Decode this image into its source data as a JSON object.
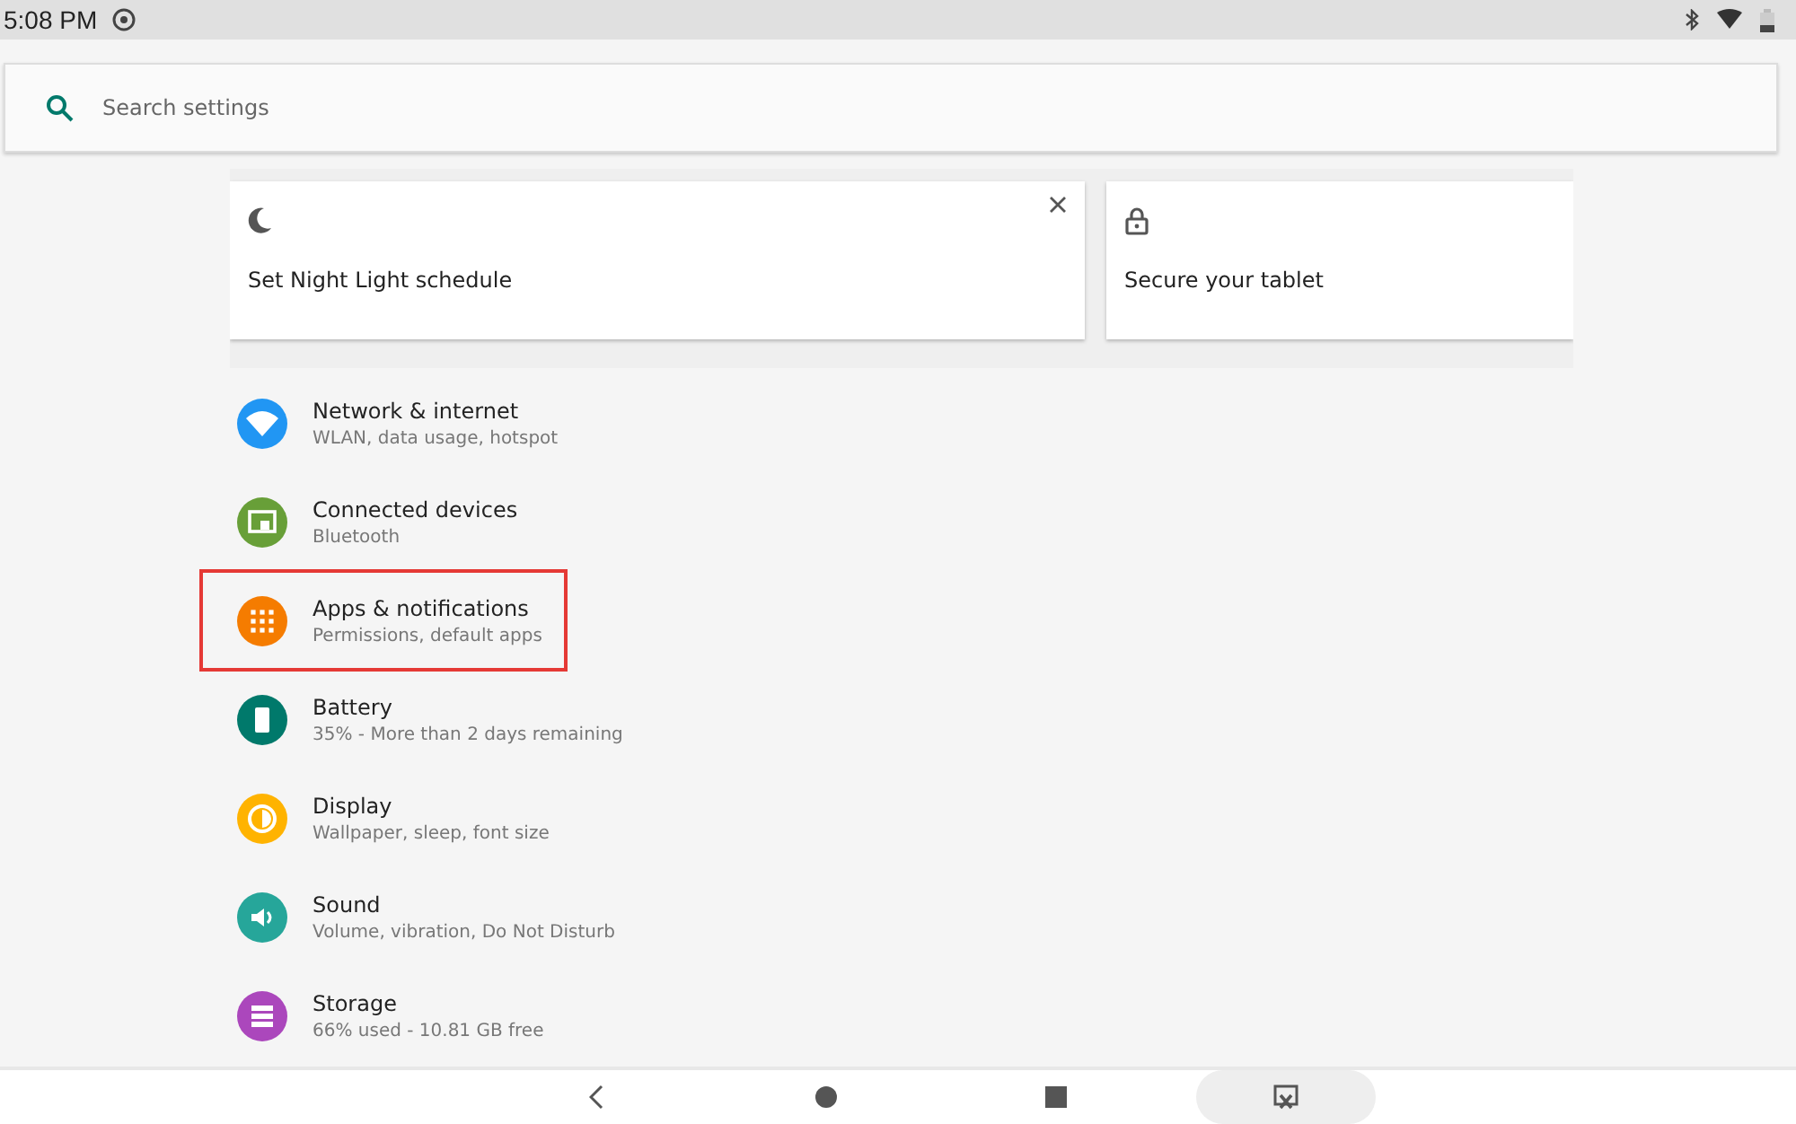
{
  "status_bar": {
    "time": "5:08 PM"
  },
  "search": {
    "placeholder": "Search settings"
  },
  "suggestions": [
    {
      "kind": "moon",
      "title": "Set Night Light schedule",
      "dismissible": true
    },
    {
      "kind": "lock",
      "title": "Secure your tablet",
      "dismissible": false
    }
  ],
  "items": [
    {
      "kind": "wifi",
      "color": "#2196f3",
      "title": "Network & internet",
      "subtitle": "WLAN, data usage, hotspot",
      "highlighted": false
    },
    {
      "kind": "devices",
      "color": "#689f38",
      "title": "Connected devices",
      "subtitle": "Bluetooth",
      "highlighted": false
    },
    {
      "kind": "apps",
      "color": "#f57c00",
      "title": "Apps & notifications",
      "subtitle": "Permissions, default apps",
      "highlighted": true
    },
    {
      "kind": "battery",
      "color": "#00796b",
      "title": "Battery",
      "subtitle": "35% - More than 2 days remaining",
      "highlighted": false
    },
    {
      "kind": "display",
      "color": "#ffb300",
      "title": "Display",
      "subtitle": "Wallpaper, sleep, font size",
      "highlighted": false
    },
    {
      "kind": "sound",
      "color": "#26a69a",
      "title": "Sound",
      "subtitle": "Volume, vibration, Do Not Disturb",
      "highlighted": false
    },
    {
      "kind": "storage",
      "color": "#ab47bc",
      "title": "Storage",
      "subtitle": "66% used - 10.81 GB free",
      "highlighted": false
    }
  ]
}
